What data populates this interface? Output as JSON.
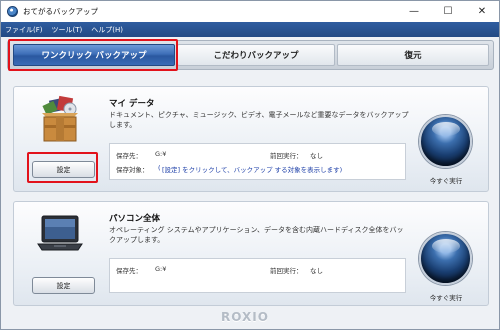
{
  "window": {
    "title": "おてがるバックアップ",
    "controls": {
      "minimize": "—",
      "maximize": "☐",
      "close": "✕"
    }
  },
  "menu": {
    "items": [
      "ファイル(F)",
      "ツール(T)",
      "ヘルプ(H)"
    ]
  },
  "tabs": [
    {
      "label": "ワンクリック バックアップ",
      "selected": true
    },
    {
      "label": "こだわりバックアップ",
      "selected": false
    },
    {
      "label": "復元",
      "selected": false
    }
  ],
  "panels": {
    "my_data": {
      "title": "マイ データ",
      "description": "ドキュメント、ピクチャ、ミュージック、ビデオ、電子メールなど重要なデータをバックアップします。",
      "save_to_label": "保存先：",
      "save_to_value": "G:¥",
      "last_run_label": "前回実行：",
      "last_run_value": "なし",
      "target_label": "保存対象：",
      "target_link": "[設定] をクリックして、バックアップ する対象を表示します)",
      "target_link_prefix": "(",
      "settings_button": "設定",
      "run_now": "今すぐ実行"
    },
    "pc_whole": {
      "title": "パソコン全体",
      "description": "オペレーティング システムやアプリケーション、データを含む内蔵ハードディスク全体をバックアップします。",
      "save_to_label": "保存先：",
      "save_to_value": "G:¥",
      "last_run_label": "前回実行：",
      "last_run_value": "なし",
      "settings_button": "設定",
      "run_now": "今すぐ実行"
    }
  },
  "footer": {
    "logo": "ROXIO"
  },
  "colors": {
    "accent": "#2a58a0",
    "highlight": "#e2121b",
    "link": "#1d3fa8"
  },
  "icons": [
    "app-icon",
    "box-icon",
    "laptop-icon",
    "run-orb-icon"
  ]
}
